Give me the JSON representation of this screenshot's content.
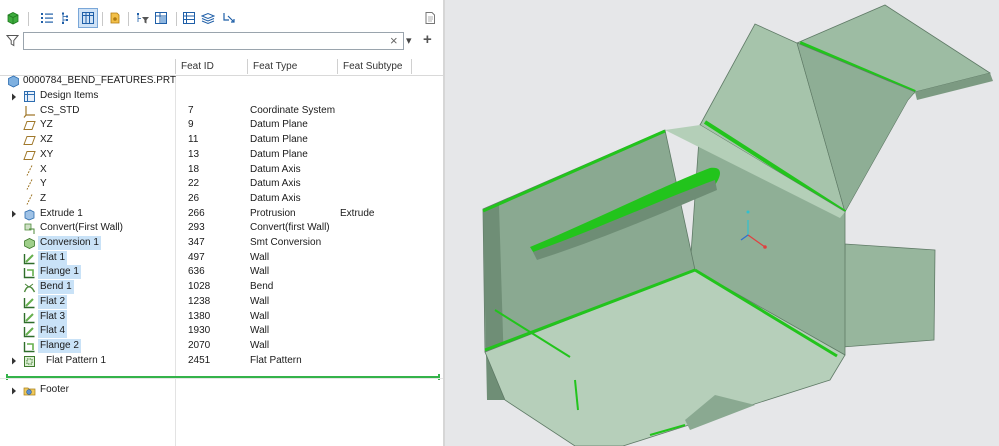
{
  "toolbar": {
    "icons": [
      "part-icon",
      "list-view-icon",
      "tree-columns-icon",
      "show-columns-icon",
      "settings-icon",
      "filter-settings-icon",
      "tree-filters-icon",
      "model-tree-columns-icon",
      "layers-icon",
      "highlight-icon",
      "notes-icon"
    ]
  },
  "filter": {
    "value": "",
    "clear": "×",
    "dropdown": "▾",
    "add": "+"
  },
  "columns": {
    "name": "",
    "feat_id": "Feat ID",
    "feat_type": "Feat Type",
    "feat_subtype": "Feat Subtype"
  },
  "tree": {
    "root": "0000784_BEND_FEATURES.PRT",
    "rows": [
      {
        "name": "Design Items",
        "id": "",
        "type": "",
        "subtype": "",
        "icon": "design-items-icon",
        "expand": true,
        "hl": false
      },
      {
        "name": "CS_STD",
        "id": "7",
        "type": "Coordinate System",
        "subtype": "",
        "icon": "coordinate-system-icon",
        "expand": false,
        "hl": false
      },
      {
        "name": "YZ",
        "id": "9",
        "type": "Datum Plane",
        "subtype": "",
        "icon": "datum-plane-icon",
        "expand": false,
        "hl": false
      },
      {
        "name": "XZ",
        "id": "11",
        "type": "Datum Plane",
        "subtype": "",
        "icon": "datum-plane-icon",
        "expand": false,
        "hl": false
      },
      {
        "name": "XY",
        "id": "13",
        "type": "Datum Plane",
        "subtype": "",
        "icon": "datum-plane-icon",
        "expand": false,
        "hl": false
      },
      {
        "name": "X",
        "id": "18",
        "type": "Datum Axis",
        "subtype": "",
        "icon": "datum-axis-icon",
        "expand": false,
        "hl": false
      },
      {
        "name": "Y",
        "id": "22",
        "type": "Datum Axis",
        "subtype": "",
        "icon": "datum-axis-icon",
        "expand": false,
        "hl": false
      },
      {
        "name": "Z",
        "id": "26",
        "type": "Datum Axis",
        "subtype": "",
        "icon": "datum-axis-icon",
        "expand": false,
        "hl": false
      },
      {
        "name": "Extrude 1",
        "id": "266",
        "type": "Protrusion",
        "subtype": "Extrude",
        "icon": "extrude-icon",
        "expand": true,
        "hl": false
      },
      {
        "name": "Convert(First Wall)",
        "id": "293",
        "type": "Convert(first Wall)",
        "subtype": "",
        "icon": "convert-icon",
        "expand": false,
        "hl": false
      },
      {
        "name": "Conversion 1",
        "id": "347",
        "type": "Smt Conversion",
        "subtype": "",
        "icon": "conversion-icon",
        "expand": false,
        "hl": true
      },
      {
        "name": "Flat 1",
        "id": "497",
        "type": "Wall",
        "subtype": "",
        "icon": "flat-wall-icon",
        "expand": false,
        "hl": true
      },
      {
        "name": "Flange 1",
        "id": "636",
        "type": "Wall",
        "subtype": "",
        "icon": "flange-wall-icon",
        "expand": false,
        "hl": true
      },
      {
        "name": "Bend 1",
        "id": "1028",
        "type": "Bend",
        "subtype": "",
        "icon": "bend-icon",
        "expand": false,
        "hl": true
      },
      {
        "name": "Flat 2",
        "id": "1238",
        "type": "Wall",
        "subtype": "",
        "icon": "flat-wall-icon",
        "expand": false,
        "hl": true
      },
      {
        "name": "Flat 3",
        "id": "1380",
        "type": "Wall",
        "subtype": "",
        "icon": "flat-wall-icon",
        "expand": false,
        "hl": true
      },
      {
        "name": "Flat 4",
        "id": "1930",
        "type": "Wall",
        "subtype": "",
        "icon": "flat-wall-icon",
        "expand": false,
        "hl": true
      },
      {
        "name": "Flange 2",
        "id": "2070",
        "type": "Wall",
        "subtype": "",
        "icon": "flange-wall-icon",
        "expand": false,
        "hl": true
      },
      {
        "name": "Flat Pattern 1",
        "id": "2451",
        "type": "Flat Pattern",
        "subtype": "",
        "icon": "flat-pattern-icon",
        "expand": true,
        "hl": false
      }
    ],
    "footer": "Footer"
  },
  "colors": {
    "selection": "#c9e2f7",
    "insert_marker": "#34b34a",
    "model_face": "#9fbea6",
    "model_edge": "#22c41c",
    "viewport_bg": "#e6e7e9"
  }
}
